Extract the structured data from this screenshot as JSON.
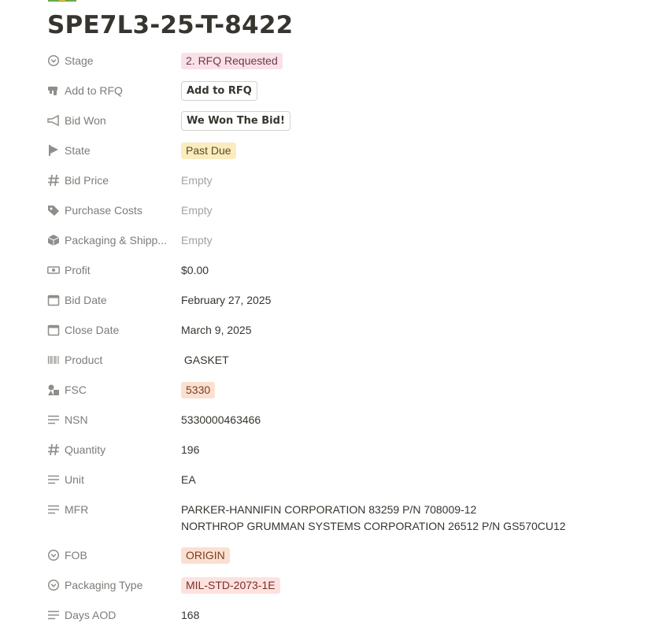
{
  "page": {
    "icon": "money-icon",
    "title": "SPE7L3-25-T-8422"
  },
  "properties": [
    {
      "icon": "stage-icon",
      "name": "Stage",
      "kind": "tag",
      "value": "2. RFQ Requested",
      "color": "#f9e1e7"
    },
    {
      "icon": "pointer-hand-icon",
      "name": "Add to RFQ",
      "kind": "button",
      "value": "Add to RFQ"
    },
    {
      "icon": "horn-icon",
      "name": "Bid Won",
      "kind": "button",
      "value": "We Won The Bid!"
    },
    {
      "icon": "flag-icon",
      "name": "State",
      "kind": "tag",
      "value": "Past Due",
      "color": "#fbecc0"
    },
    {
      "icon": "hash-icon",
      "name": "Bid Price",
      "kind": "empty",
      "value": "Empty"
    },
    {
      "icon": "tag-icon",
      "name": "Purchase Costs",
      "kind": "empty",
      "value": "Empty"
    },
    {
      "icon": "box-icon",
      "name": "Packaging & Shipp...",
      "kind": "empty",
      "value": "Empty"
    },
    {
      "icon": "money-bill-icon",
      "name": "Profit",
      "kind": "text",
      "value": "$0.00"
    },
    {
      "icon": "calendar-icon",
      "name": "Bid Date",
      "kind": "text",
      "value": "February 27, 2025"
    },
    {
      "icon": "calendar-icon",
      "name": "Close Date",
      "kind": "text",
      "value": "March 9, 2025"
    },
    {
      "icon": "barcode-icon",
      "name": "Product",
      "kind": "text",
      "value": " GASKET"
    },
    {
      "icon": "shapes-icon",
      "name": "FSC",
      "kind": "tag",
      "value": "5330",
      "color": "#fbe0d2"
    },
    {
      "icon": "text-lines-icon",
      "name": "NSN",
      "kind": "text",
      "value": "5330000463466"
    },
    {
      "icon": "hash-icon",
      "name": "Quantity",
      "kind": "text",
      "value": "196"
    },
    {
      "icon": "text-lines-icon",
      "name": "Unit",
      "kind": "text",
      "value": "EA"
    },
    {
      "icon": "text-lines-icon",
      "name": "MFR",
      "kind": "multiline",
      "lines": [
        "PARKER-HANNIFIN CORPORATION 83259 P/N 708009-12",
        "NORTHROP GRUMMAN SYSTEMS CORPORATION 26512 P/N GS570CU12"
      ]
    },
    {
      "icon": "stage-icon",
      "name": "FOB",
      "kind": "tag",
      "value": "ORIGIN",
      "color": "#fbe0d2"
    },
    {
      "icon": "stage-icon",
      "name": "Packaging Type",
      "kind": "tag",
      "value": "MIL-STD-2073-1E",
      "color": "#fde2df"
    },
    {
      "icon": "text-lines-icon",
      "name": "Days AOD",
      "kind": "text",
      "value": "168"
    }
  ]
}
